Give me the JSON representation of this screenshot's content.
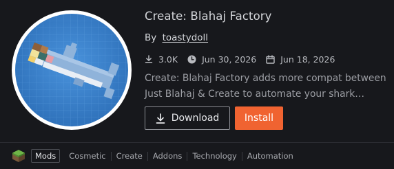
{
  "project": {
    "title": "Create: Blahaj Factory",
    "by_label": "By",
    "author": "toastydoll",
    "downloads": "3.0K",
    "updated": "Jun 30, 2026",
    "created": "Jun 18, 2026",
    "description": "Create: Blahaj Factory adds more compat between Just Blahaj & Create to automate your shark…"
  },
  "actions": {
    "download_label": "Download",
    "install_label": "Install"
  },
  "tags": {
    "active": "Mods",
    "items": [
      "Cosmetic",
      "Create",
      "Addons",
      "Technology",
      "Automation"
    ]
  },
  "icons": {
    "downloads": "download-icon",
    "updated": "clock-icon",
    "created": "calendar-icon",
    "download_button": "download-icon",
    "category": "grass-block-icon",
    "thumbnail": "blahaj-shark-logo"
  },
  "colors": {
    "background": "#17181c",
    "install_button": "#f06331",
    "thumbnail_blue": "#3f86d0"
  }
}
